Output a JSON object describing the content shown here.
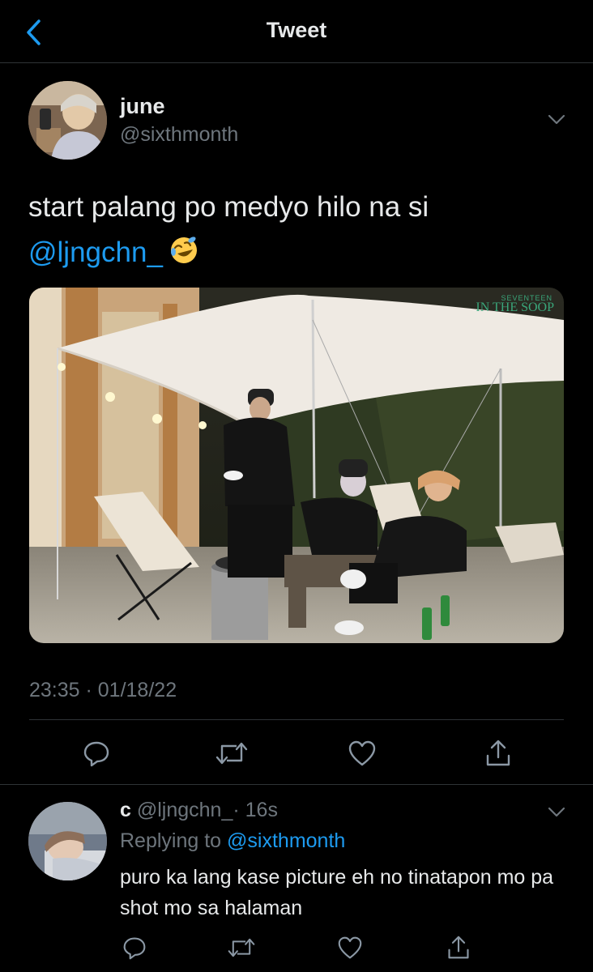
{
  "header": {
    "title": "Tweet"
  },
  "tweet": {
    "display_name": "june",
    "handle": "@sixthmonth",
    "text": "start palang po medyo hilo na si",
    "mention": "@ljngchn_",
    "media": {
      "watermark_small": "SEVENTEEN",
      "watermark": "IN THE SOOP"
    },
    "timestamp": "23:35 · 01/18/22",
    "actions": [
      "reply-icon",
      "retweet-icon",
      "like-icon",
      "share-icon"
    ]
  },
  "reply": {
    "display_name": "c",
    "handle": "@ljngchn_",
    "time": "· 16s",
    "replying_prefix": "Replying to",
    "replying_to": "@sixthmonth",
    "text": "puro ka lang kase picture eh no tinatapon mo pa shot mo sa halaman"
  },
  "colors": {
    "accent": "#1d9bf0",
    "muted": "#6e767d",
    "text": "#e7e9ea",
    "background": "#000000",
    "divider": "#2f3336"
  }
}
